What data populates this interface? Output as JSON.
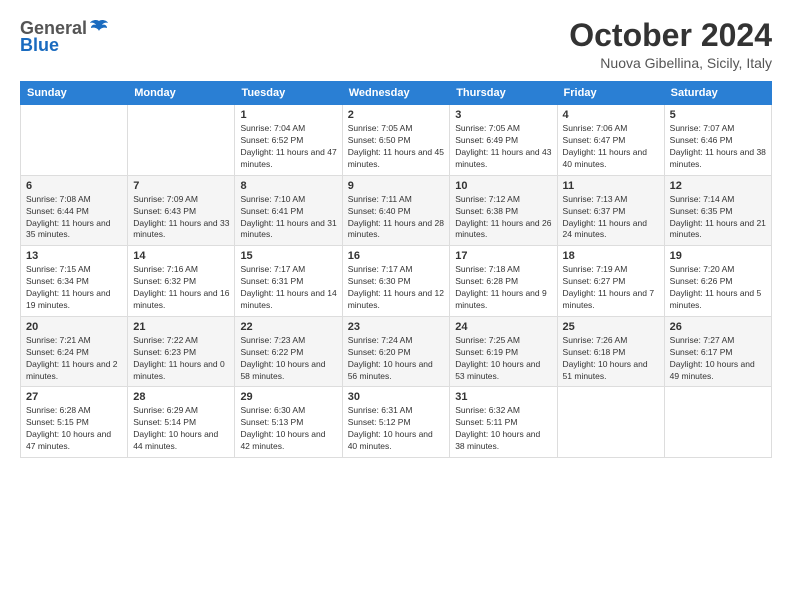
{
  "header": {
    "logo_general": "General",
    "logo_blue": "Blue",
    "month_title": "October 2024",
    "location": "Nuova Gibellina, Sicily, Italy"
  },
  "days_of_week": [
    "Sunday",
    "Monday",
    "Tuesday",
    "Wednesday",
    "Thursday",
    "Friday",
    "Saturday"
  ],
  "weeks": [
    [
      {
        "num": "",
        "detail": ""
      },
      {
        "num": "",
        "detail": ""
      },
      {
        "num": "1",
        "detail": "Sunrise: 7:04 AM\nSunset: 6:52 PM\nDaylight: 11 hours and 47 minutes."
      },
      {
        "num": "2",
        "detail": "Sunrise: 7:05 AM\nSunset: 6:50 PM\nDaylight: 11 hours and 45 minutes."
      },
      {
        "num": "3",
        "detail": "Sunrise: 7:05 AM\nSunset: 6:49 PM\nDaylight: 11 hours and 43 minutes."
      },
      {
        "num": "4",
        "detail": "Sunrise: 7:06 AM\nSunset: 6:47 PM\nDaylight: 11 hours and 40 minutes."
      },
      {
        "num": "5",
        "detail": "Sunrise: 7:07 AM\nSunset: 6:46 PM\nDaylight: 11 hours and 38 minutes."
      }
    ],
    [
      {
        "num": "6",
        "detail": "Sunrise: 7:08 AM\nSunset: 6:44 PM\nDaylight: 11 hours and 35 minutes."
      },
      {
        "num": "7",
        "detail": "Sunrise: 7:09 AM\nSunset: 6:43 PM\nDaylight: 11 hours and 33 minutes."
      },
      {
        "num": "8",
        "detail": "Sunrise: 7:10 AM\nSunset: 6:41 PM\nDaylight: 11 hours and 31 minutes."
      },
      {
        "num": "9",
        "detail": "Sunrise: 7:11 AM\nSunset: 6:40 PM\nDaylight: 11 hours and 28 minutes."
      },
      {
        "num": "10",
        "detail": "Sunrise: 7:12 AM\nSunset: 6:38 PM\nDaylight: 11 hours and 26 minutes."
      },
      {
        "num": "11",
        "detail": "Sunrise: 7:13 AM\nSunset: 6:37 PM\nDaylight: 11 hours and 24 minutes."
      },
      {
        "num": "12",
        "detail": "Sunrise: 7:14 AM\nSunset: 6:35 PM\nDaylight: 11 hours and 21 minutes."
      }
    ],
    [
      {
        "num": "13",
        "detail": "Sunrise: 7:15 AM\nSunset: 6:34 PM\nDaylight: 11 hours and 19 minutes."
      },
      {
        "num": "14",
        "detail": "Sunrise: 7:16 AM\nSunset: 6:32 PM\nDaylight: 11 hours and 16 minutes."
      },
      {
        "num": "15",
        "detail": "Sunrise: 7:17 AM\nSunset: 6:31 PM\nDaylight: 11 hours and 14 minutes."
      },
      {
        "num": "16",
        "detail": "Sunrise: 7:17 AM\nSunset: 6:30 PM\nDaylight: 11 hours and 12 minutes."
      },
      {
        "num": "17",
        "detail": "Sunrise: 7:18 AM\nSunset: 6:28 PM\nDaylight: 11 hours and 9 minutes."
      },
      {
        "num": "18",
        "detail": "Sunrise: 7:19 AM\nSunset: 6:27 PM\nDaylight: 11 hours and 7 minutes."
      },
      {
        "num": "19",
        "detail": "Sunrise: 7:20 AM\nSunset: 6:26 PM\nDaylight: 11 hours and 5 minutes."
      }
    ],
    [
      {
        "num": "20",
        "detail": "Sunrise: 7:21 AM\nSunset: 6:24 PM\nDaylight: 11 hours and 2 minutes."
      },
      {
        "num": "21",
        "detail": "Sunrise: 7:22 AM\nSunset: 6:23 PM\nDaylight: 11 hours and 0 minutes."
      },
      {
        "num": "22",
        "detail": "Sunrise: 7:23 AM\nSunset: 6:22 PM\nDaylight: 10 hours and 58 minutes."
      },
      {
        "num": "23",
        "detail": "Sunrise: 7:24 AM\nSunset: 6:20 PM\nDaylight: 10 hours and 56 minutes."
      },
      {
        "num": "24",
        "detail": "Sunrise: 7:25 AM\nSunset: 6:19 PM\nDaylight: 10 hours and 53 minutes."
      },
      {
        "num": "25",
        "detail": "Sunrise: 7:26 AM\nSunset: 6:18 PM\nDaylight: 10 hours and 51 minutes."
      },
      {
        "num": "26",
        "detail": "Sunrise: 7:27 AM\nSunset: 6:17 PM\nDaylight: 10 hours and 49 minutes."
      }
    ],
    [
      {
        "num": "27",
        "detail": "Sunrise: 6:28 AM\nSunset: 5:15 PM\nDaylight: 10 hours and 47 minutes."
      },
      {
        "num": "28",
        "detail": "Sunrise: 6:29 AM\nSunset: 5:14 PM\nDaylight: 10 hours and 44 minutes."
      },
      {
        "num": "29",
        "detail": "Sunrise: 6:30 AM\nSunset: 5:13 PM\nDaylight: 10 hours and 42 minutes."
      },
      {
        "num": "30",
        "detail": "Sunrise: 6:31 AM\nSunset: 5:12 PM\nDaylight: 10 hours and 40 minutes."
      },
      {
        "num": "31",
        "detail": "Sunrise: 6:32 AM\nSunset: 5:11 PM\nDaylight: 10 hours and 38 minutes."
      },
      {
        "num": "",
        "detail": ""
      },
      {
        "num": "",
        "detail": ""
      }
    ]
  ]
}
